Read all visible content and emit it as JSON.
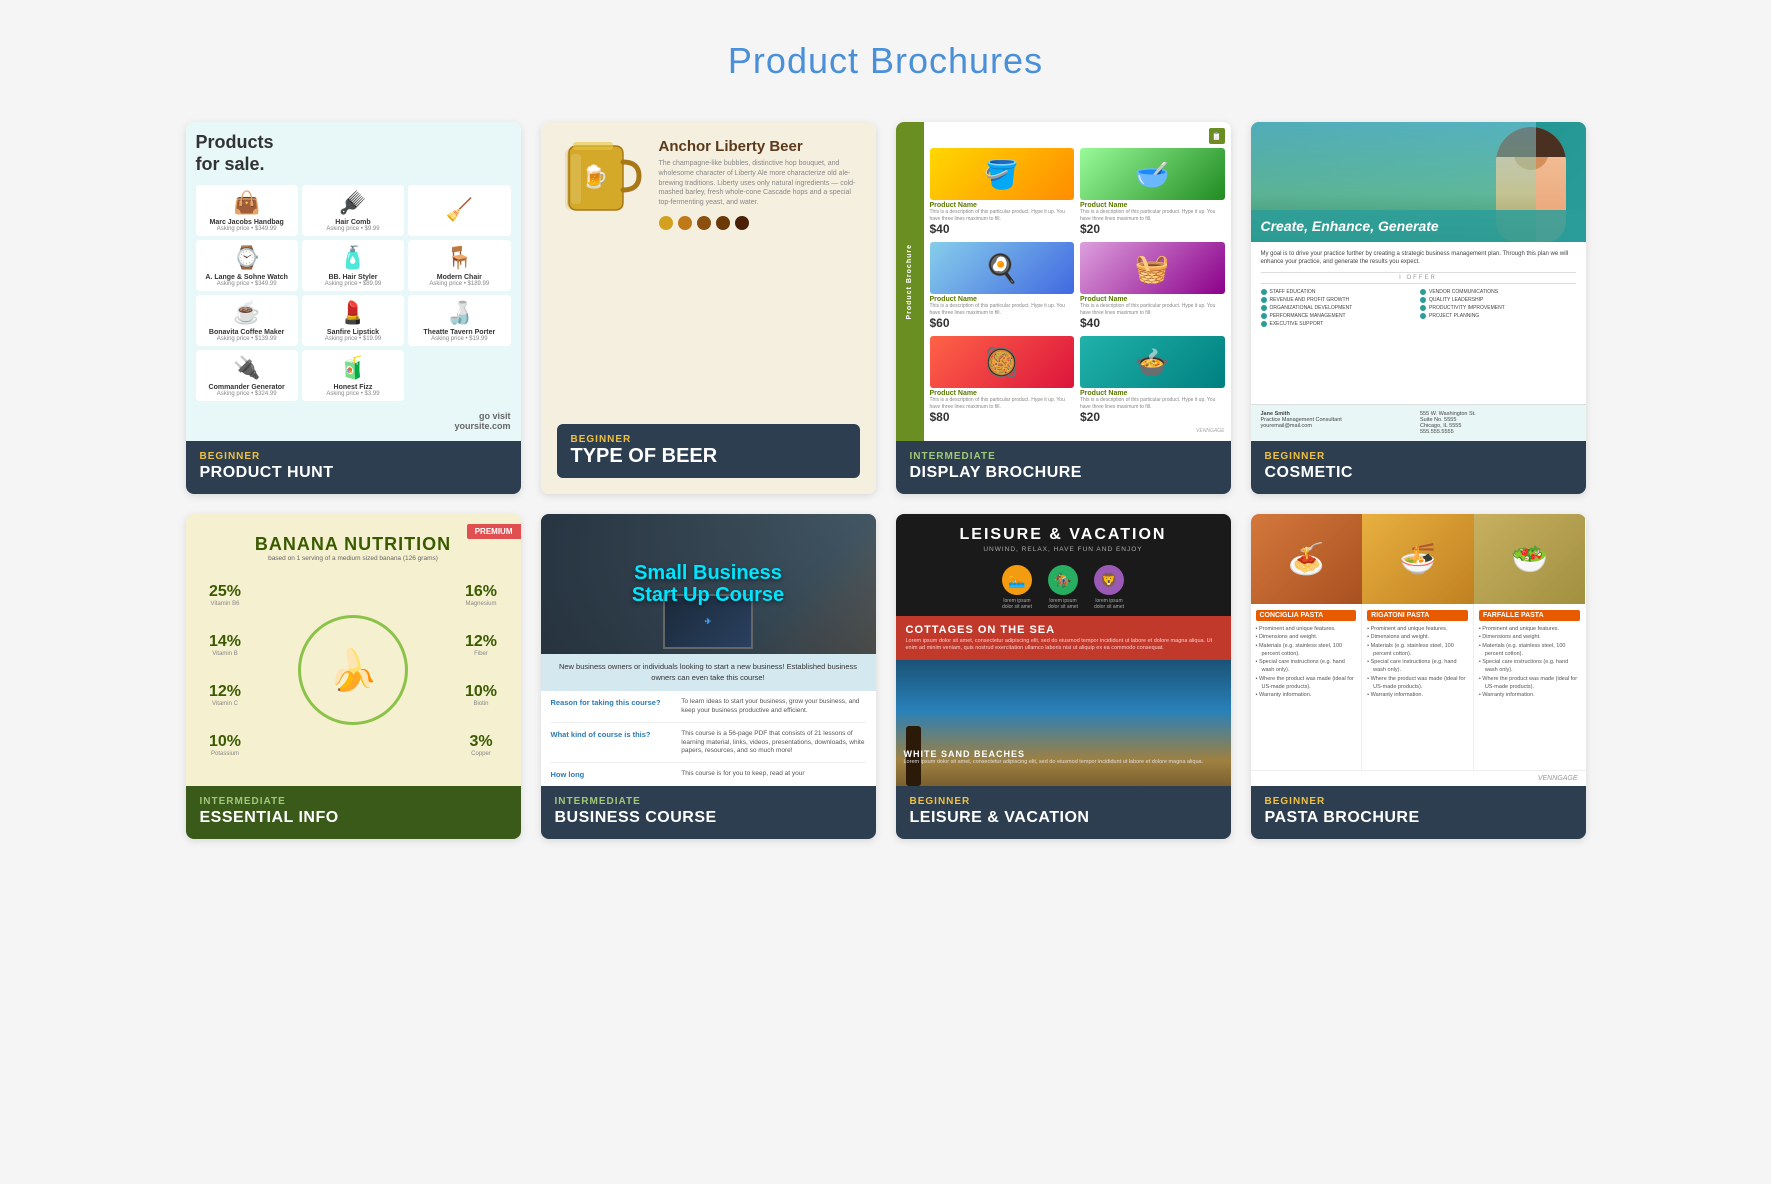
{
  "page": {
    "title": "Product Brochures",
    "title_color": "#4a90d9"
  },
  "cards": [
    {
      "id": "product-hunt",
      "level": "BEGINNER",
      "level_color": "#f0c040",
      "name": "PRODUCT HUNT",
      "preview_type": "product-hunt",
      "items": [
        {
          "name": "Marc Jacobs Handbag",
          "price": "Asking price • $349.99",
          "icon": "handbag"
        },
        {
          "name": "Hair Comb",
          "price": "Asking price • $9.99",
          "icon": "comb"
        },
        {
          "name": "",
          "price": "",
          "icon": "broom"
        },
        {
          "name": "A. Lange & Sohne Watch",
          "price": "Asking price • $349.99",
          "icon": "watch"
        },
        {
          "name": "BB. Hair Styler",
          "price": "Asking price • $89.99",
          "icon": "bottle"
        },
        {
          "name": "Modern Chair",
          "price": "Asking price • $189.99",
          "icon": "chair"
        },
        {
          "name": "Bonavita Coffee Maker",
          "price": "Asking price • $139.99",
          "icon": "coffee"
        },
        {
          "name": "Sanfire Lipstick",
          "price": "Asking price • $19.99",
          "icon": "lipstick"
        },
        {
          "name": "Theatte Tavern Porter",
          "price": "Asking price • $19.99",
          "icon": "beer-bottles"
        },
        {
          "name": "Commander Generator",
          "price": "Asking price • $324.99",
          "icon": "generator"
        },
        {
          "name": "Honest Fizz",
          "price": "Asking price • $3.99",
          "icon": "bottles"
        }
      ],
      "cta": "go visit",
      "website": "yoursite.com"
    },
    {
      "id": "beer",
      "level": "BEGINNER",
      "level_color": "#f0c040",
      "name": "TYPE OF BEER",
      "preview_type": "beer",
      "beer_name": "Anchor Liberty Beer",
      "beer_desc": "The champagne-like bubbles, distinctive hop bouquet, and wholesome character of Liberty Ale more characterize old ale-brewing traditions. Liberty uses only natural ingredients — cold-mashed barley, fresh whole-cone Cascade hops and a special top-fermenting yeast, and water.",
      "colors": [
        "#d4a020",
        "#c07818",
        "#8b5010",
        "#6b3808",
        "#4a2008"
      ],
      "beer_level": "BEGINNER",
      "beer_type": "TYPE OF BEER"
    },
    {
      "id": "display-brochure",
      "level": "INTERMEDIATE",
      "level_color": "#a0c878",
      "name": "DISPLAY BROCHURE",
      "preview_type": "display",
      "sidebar_text": "Product Brochure",
      "sidebar_logo": "VENNGAGE",
      "products": [
        {
          "name": "Product Name",
          "desc": "This is a description of this particular product. Hype it up. You have three lines maximum to fill.",
          "price": "$40"
        },
        {
          "name": "Product Name",
          "desc": "This is a description of this particular product. Hype it up. You have three lines maximum to fill.",
          "price": "$20"
        },
        {
          "name": "Product Name",
          "desc": "This is a description of this particular product. Hype it up. You have three lines maximum to fill.",
          "price": "$60"
        },
        {
          "name": "Product Name",
          "desc": "This is a description of this particular product. Hype it up. You have three lines maximum to fill.",
          "price": "$40"
        },
        {
          "name": "Product Name",
          "desc": "This is a description of this particular product. Hype it up. You have three lines maximum to fill.",
          "price": "$80"
        },
        {
          "name": "Product Name",
          "desc": "This is a description of this particular product. Hype it up. You have three lines maximum to fill.",
          "price": "$20"
        }
      ]
    },
    {
      "id": "cosmetic",
      "level": "BEGINNER",
      "level_color": "#f0c040",
      "name": "COSMETIC",
      "preview_type": "cosmetic",
      "headline": "Create, Enhance, Generate",
      "desc": "My goal is to drive your practice further by creating a strategic business management plan. Through this plan we will enhance your practice, and generate the results you expect.",
      "divider": "I OFFER",
      "services": [
        "STAFF EDUCATION",
        "VENDOR COMMUNICATIONS",
        "REVENUE AND PROFIT GROWTH",
        "QUALITY LEADERSHIP",
        "ORGANIZATIONAL DEVELOPMENT",
        "PRODUCTIVITY IMPROVEMENT",
        "PERFORMANCE MANAGEMENT",
        "PROJECT PLANNING",
        "EXECUTIVE SUPPORT"
      ],
      "contact": {
        "name": "Jane Smith",
        "title": "Practice Management Consultant",
        "email": "youremail@mail.com",
        "address": "555 W. Washington St. Suite No. 5555 Chicago, IL 5555 555.555.5555"
      }
    },
    {
      "id": "essential-info",
      "level": "INTERMEDIATE",
      "level_color": "#a0c878",
      "name": "ESSENTIAL INFO",
      "preview_type": "banana",
      "badge": "PREMIUM",
      "title": "BANANA NUTRITION",
      "subtitle": "based on 1 serving of a medium sized banana (126 grams)",
      "stats_left": [
        {
          "pct": "25%",
          "label": "Vitamin B6"
        },
        {
          "pct": "14%",
          "label": "Vitamin B"
        },
        {
          "pct": "12%",
          "label": "Vitamin C"
        },
        {
          "pct": "10%",
          "label": "Potassium"
        }
      ],
      "stats_right": [
        {
          "pct": "16%",
          "label": "Magnesium"
        },
        {
          "pct": "12%",
          "label": "Fiber"
        },
        {
          "pct": "10%",
          "label": "Biotin"
        },
        {
          "pct": "3%",
          "label": "Copper"
        }
      ]
    },
    {
      "id": "business-course",
      "level": "INTERMEDIATE",
      "level_color": "#a0c878",
      "name": "BUSINESS COURSE",
      "preview_type": "business",
      "title_line1": "Small Business",
      "title_line2": "Start Up Course",
      "subtitle": "New business owners or individuals looking to start a new business! Established business owners can even take this course!",
      "qa": [
        {
          "q": "Reason for taking this course?",
          "a": "To learn ideas to start your business, grow your business, and keep your business productive and efficient."
        },
        {
          "q": "What kind of course is this?",
          "a": "This course is a 56-page PDF that consists of 21 lessons of learning material, links, videos, presentations, downloads, white papers, resources, and so much more!"
        },
        {
          "q": "How long",
          "a": "This course is for you to keep, read at your"
        }
      ]
    },
    {
      "id": "leisure-vacation",
      "level": "BEGINNER",
      "level_color": "#f0c040",
      "name": "LEISURE & VACATION",
      "preview_type": "leisure",
      "title": "LEISURE & VACATION",
      "subtitle": "UNWIND, RELAX, HAVE FUN AND ENJOY",
      "icons": [
        {
          "emoji": "🏊",
          "color": "#f39c12",
          "label": "lorem ipsum\ndolor sit amet"
        },
        {
          "emoji": "🏇",
          "color": "#27ae60",
          "label": "lorem ipsum\ndolor sit amet"
        },
        {
          "emoji": "🦁",
          "color": "#9b59b6",
          "label": "lorem ipsum\ndolor sit amet"
        }
      ],
      "red_section": {
        "title": "COTTAGES ON THE SEA",
        "desc": "Lorem ipsum dolor sit amet, consectetur adipiscing elit, sed do eiusmod tempor incididunt ut labore et dolore magna aliqua. Ut enim ad minim veniam, quis nostrud exercitation ullamco laboris nisi ut aliquip ex ea commodo consequat."
      },
      "beach_section": {
        "title": "WHITE SAND BEACHES",
        "desc": "Lorem ipsum dolor sit amet, consectetur adipiscing elit, sed do eiusmod tempor incididunt ut labore et dolore magna aliqua."
      }
    },
    {
      "id": "pasta-brochure",
      "level": "BEGINNER",
      "level_color": "#f0c040",
      "name": "PASTA BROCHURE",
      "preview_type": "pasta",
      "columns": [
        {
          "title": "CONCIGLIA PASTA",
          "color": "#e85a00",
          "bullets": [
            "Prominent and unique features.",
            "Dimensions and weight.",
            "Materials (e.g. stainless steel, 100 percent cotton).",
            "Special care instructions (e.g. hand wash only).",
            "Where the product was made (ideal for US-made products).",
            "Warranty information."
          ]
        },
        {
          "title": "RIGATONI PASTA",
          "color": "#e85a00",
          "bullets": [
            "Prominent and unique features.",
            "Dimensions and weight.",
            "Materials (e.g. stainless steel, 100 percent cotton).",
            "Special care instructions (e.g. hand wash only).",
            "Where the product was made (ideal for US-made products).",
            "Warranty information."
          ]
        },
        {
          "title": "FARFALLE PASTA",
          "color": "#e85a00",
          "bullets": [
            "Prominent and unique features.",
            "Dimensions and weight.",
            "Materials (e.g. stainless steel, 100 percent cotton).",
            "Special care instructions (e.g. hand wash only).",
            "Where the product was made (ideal for US-made products).",
            "Warranty information."
          ]
        }
      ],
      "logo": "VENNGAGE"
    }
  ]
}
